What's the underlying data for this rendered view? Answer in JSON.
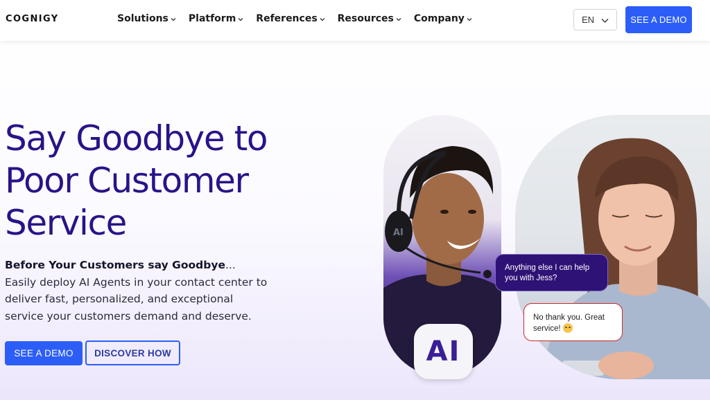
{
  "brand": {
    "logo_text": "COGNIGY"
  },
  "nav": {
    "items": [
      {
        "label": "Solutions"
      },
      {
        "label": "Platform"
      },
      {
        "label": "References"
      },
      {
        "label": "Resources"
      },
      {
        "label": "Company"
      }
    ]
  },
  "header": {
    "language": "EN",
    "demo_label": "SEE A DEMO"
  },
  "hero": {
    "title_lines": [
      "Say Goodbye to",
      "Poor Customer",
      "Service"
    ],
    "desc_bold": "Before Your Customers say Goodbye",
    "desc_rest": "... Easily deploy AI Agents in your contact center to deliver fast, personalized, and exceptional service your customers demand and deserve.",
    "primary_cta": "SEE A DEMO",
    "secondary_cta": "DISCOVER HOW"
  },
  "visual": {
    "ai_badge_text": "AI",
    "agent_message": "Anything else I can help you with Jess?",
    "customer_message": "No thank you. Great service!"
  },
  "colors": {
    "accent": "#2c5ef7",
    "title": "#2a1388",
    "agent_bubble": "#2e1275"
  },
  "icons": {
    "nav_dropdown": "chevron-down-icon",
    "language_dropdown": "chevron-down-icon",
    "emoji": "smile-emoji-icon"
  }
}
